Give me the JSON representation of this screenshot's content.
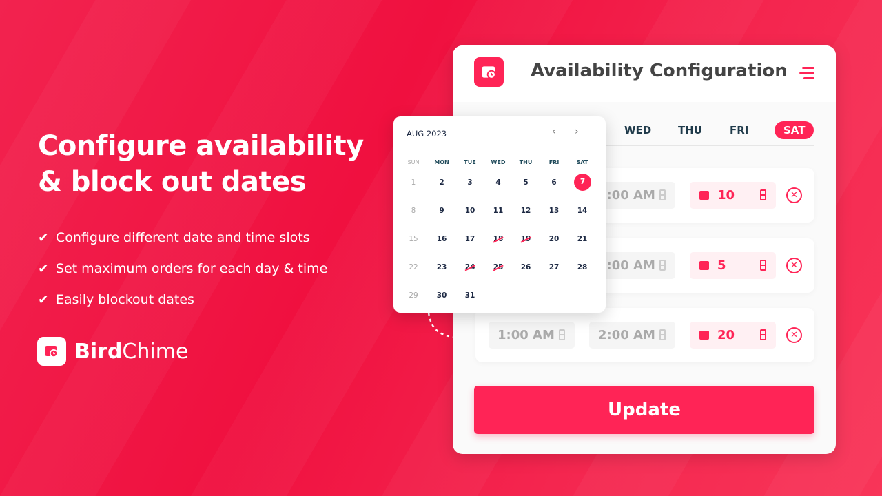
{
  "hero": {
    "title_line1": "Configure availability",
    "title_line2": "& block out dates",
    "bullets": [
      "Configure different date and time slots",
      "Set maximum orders for each day & time",
      "Easily blockout dates"
    ]
  },
  "brand": {
    "name_bold": "Bird",
    "name_regular": "Chime"
  },
  "panel": {
    "title": "Availability Configuration",
    "days": [
      {
        "label": "WED",
        "active": false
      },
      {
        "label": "THU",
        "active": false
      },
      {
        "label": "FRI",
        "active": false
      },
      {
        "label": "SAT",
        "active": true
      }
    ],
    "rows": [
      {
        "from": "",
        "to": "1:00 AM",
        "qty": "10"
      },
      {
        "from": "",
        "to": "2:00 AM",
        "qty": "5"
      },
      {
        "from": "1:00 AM",
        "to": "2:00 AM",
        "qty": "20"
      }
    ],
    "update_label": "Update"
  },
  "calendar": {
    "month": "AUG 2023",
    "prev": "‹",
    "next": "›",
    "weekdays": [
      "SUN",
      "MON",
      "TUE",
      "WED",
      "THU",
      "FRI",
      "SAT"
    ],
    "weeks": [
      [
        "1",
        "2",
        "3",
        "4",
        "5",
        "6",
        "7"
      ],
      [
        "8",
        "9",
        "10",
        "11",
        "12",
        "13",
        "14"
      ],
      [
        "15",
        "16",
        "17",
        "18",
        "19",
        "20",
        "21"
      ],
      [
        "22",
        "23",
        "24",
        "25",
        "26",
        "27",
        "28"
      ],
      [
        "29",
        "30",
        "31"
      ]
    ],
    "selected": "7",
    "blocked": [
      "18",
      "19",
      "24",
      "25"
    ]
  },
  "colors": {
    "accent": "#ff2456",
    "text_dark": "#1e2a44"
  }
}
